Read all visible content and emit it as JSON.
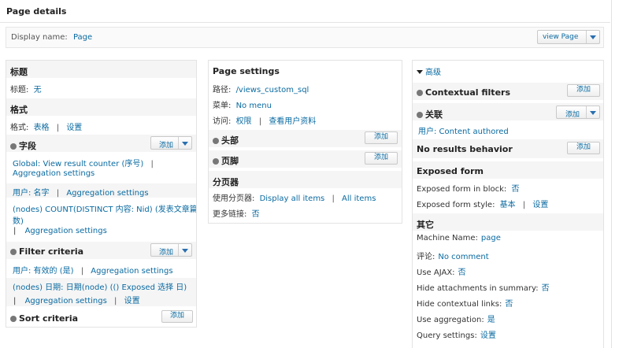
{
  "page_title": "Page details",
  "display": {
    "label": "Display name:",
    "value": "Page",
    "view_button": "view Page"
  },
  "col1": {
    "title_section": {
      "header": "标题",
      "label": "标题:",
      "value": "无"
    },
    "format_section": {
      "header": "格式",
      "label": "格式:",
      "value": "表格",
      "settings": "设置"
    },
    "fields": {
      "header": "字段",
      "add": "添加",
      "items": [
        {
          "line1": "Global: View result counter (序号)",
          "sep": "|",
          "line2": "Aggregation settings"
        },
        {
          "name": "用户: 名字",
          "sep": "|",
          "agg": "Aggregation settings"
        },
        {
          "line1": "(nodes) COUNT(DISTINCT 内容: Nid) (发表文章篇",
          "line1b": "数)",
          "sep": "|",
          "line2": "Aggregation settings"
        }
      ]
    },
    "filter": {
      "header": "Filter criteria",
      "add": "添加",
      "items": [
        {
          "name": "用户: 有效的 (是)",
          "sep": "|",
          "agg": "Aggregation settings"
        },
        {
          "line1": "(nodes) 日期: 日期(node) (() Exposed 选择 日)",
          "sep1": "|",
          "agg": "Aggregation settings",
          "sep2": "|",
          "settings": "设置"
        }
      ]
    },
    "sort": {
      "header": "Sort criteria",
      "add": "添加"
    }
  },
  "col2": {
    "page_settings": {
      "header": "Page settings",
      "path_label": "路径:",
      "path_value": "/views_custom_sql",
      "menu_label": "菜单:",
      "menu_value": "No menu",
      "access_label": "访问:",
      "access_value": "权限",
      "access_sep": "|",
      "access_extra": "查看用户资料"
    },
    "header_section": {
      "header": "头部",
      "add": "添加"
    },
    "footer_section": {
      "header": "页脚",
      "add": "添加"
    },
    "pager": {
      "header": "分页器",
      "use_label": "使用分页器:",
      "use_value": "Display all items",
      "use_sep": "|",
      "use_extra": "All items",
      "more_label": "更多链接:",
      "more_value": "否"
    }
  },
  "col3": {
    "advanced": "高级",
    "contextual": {
      "header": "Contextual filters",
      "add": "添加"
    },
    "relationship": {
      "header": "关联",
      "add": "添加",
      "item": "用户: Content authored"
    },
    "no_results": {
      "header": "No results behavior",
      "add": "添加"
    },
    "exposed": {
      "header": "Exposed form",
      "in_block_label": "Exposed form in block:",
      "in_block_value": "否",
      "style_label": "Exposed form style:",
      "style_value": "基本",
      "style_sep": "|",
      "style_settings": "设置"
    },
    "other": {
      "header": "其它",
      "items": [
        {
          "label": "Machine Name:",
          "value": "page"
        },
        {
          "label": "评论:",
          "value": "No comment"
        },
        {
          "label": "Use AJAX:",
          "value": "否"
        },
        {
          "label": "Hide attachments in summary:",
          "value": "否"
        },
        {
          "label": "Hide contextual links:",
          "value": "否"
        },
        {
          "label": "Use aggregation:",
          "value": "是"
        },
        {
          "label": "Query settings:",
          "value": "设置"
        }
      ]
    }
  }
}
